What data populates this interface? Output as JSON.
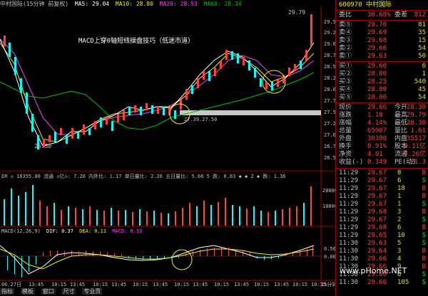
{
  "header": {
    "title": "中村国际(15分钟 前复权)",
    "ma": [
      {
        "label": "MA5: 29.04",
        "color": "#ffffff"
      },
      {
        "label": "MA10: 28.80",
        "color": "#f0f000"
      },
      {
        "label": "MA20: 28.53",
        "color": "#ff40ff"
      },
      {
        "label": "MA60: 28.34",
        "color": "#00c000"
      }
    ]
  },
  "chart_main": {
    "annotation": "MACD上穿0轴短线操盘技巧（低迷市道）",
    "high_label": "29.79",
    "low_label": "26.30",
    "mid_label": "27.39.27.50",
    "y_ticks": [
      "29.50",
      "29.25",
      "29.00",
      "28.75",
      "28.50",
      "28.25",
      "28.00",
      "27.75",
      "27.50",
      "27.25",
      "27.00",
      "26.75",
      "26.50"
    ],
    "highlight_color": "#c8c8c8"
  },
  "chart_vol": {
    "info": "ER ◇ 18355.00   流通 ◇亿◇: 7.26  内外比: 1.17  单日量比: 2.26  五日量比: 5.66  5 跌: 0.63  ◆ ◆  2 ◆ 跌: 1.36",
    "y_ticks": [
      "20000",
      "10000"
    ]
  },
  "chart_macd": {
    "info_parts": [
      {
        "text": "MACD(12,26,9)",
        "color": "#c0c0c0"
      },
      {
        "text": "DIF: 0.37",
        "color": "#ffffff"
      },
      {
        "text": "DEA: 0.11",
        "color": "#f0f000"
      },
      {
        "text": "MACD: 0.53",
        "color": "#ff40ff"
      }
    ],
    "y_ticks": [
      "0.50",
      "0.00"
    ]
  },
  "x_axis": [
    "06.27日",
    "13:45",
    "10:15",
    "13:45",
    "10:15",
    "13:45",
    "10:15",
    "13:45",
    "10:15",
    "13:45",
    "10:15",
    "13:45",
    "10:15",
    "13:45",
    "10:15",
    "10:15",
    "15分钟"
  ],
  "tabs": [
    "指标",
    "模板",
    "窗口",
    "尺寸",
    "专业页"
  ],
  "right": {
    "top_title": "600970  中村国际",
    "webi": {
      "label": "委比",
      "value": "30.68%",
      "label2": "委差",
      "value2": "812"
    },
    "sells": [
      {
        "label": "卖⑤",
        "price": "29.70",
        "vol": "81"
      },
      {
        "label": "卖④",
        "price": "29.69",
        "vol": "35"
      },
      {
        "label": "卖③",
        "price": "29.68",
        "vol": "15"
      },
      {
        "label": "卖②",
        "price": "29.66",
        "vol": "54"
      },
      {
        "label": "卖①",
        "price": "29.63",
        "vol": "50"
      }
    ],
    "buys": [
      {
        "label": "买①",
        "price": "29.60",
        "vol": "6"
      },
      {
        "label": "买②",
        "price": "28.80",
        "vol": "1"
      },
      {
        "label": "买③",
        "price": "28.25",
        "vol": "540"
      },
      {
        "label": "买④",
        "price": "28.00",
        "vol": "45"
      },
      {
        "label": "买⑤",
        "price": "28.00",
        "vol": "54"
      }
    ],
    "stats": [
      {
        "l1": "现价",
        "v1": "29.66",
        "l2": "今开",
        "v2": "28.30"
      },
      {
        "l1": "涨跌",
        "v1": "1.18",
        "l2": "最高",
        "v2": "29.79"
      },
      {
        "l1": "涨幅",
        "v1": "4.14%",
        "l2": "最低",
        "v2": "28.30"
      },
      {
        "l1": "总量",
        "v1": "65907",
        "l2": "量比",
        "v2": "1.61"
      },
      {
        "l1": "外盘",
        "v1": "30390",
        "l2": "内盘",
        "v2": "35517"
      },
      {
        "l1": "换手",
        "v1": "0.91%",
        "l2": "股本",
        "v2": "9.11亿"
      },
      {
        "l1": "净资",
        "v1": "4.01",
        "l2": "流通",
        "v2": "7.26亿"
      },
      {
        "l1": "收益(-)",
        "v1": "0.349",
        "l2": "PE(动)",
        "v2": "21.3"
      }
    ],
    "ticks": [
      {
        "t": "11:29",
        "p": "29.67",
        "v": "8",
        "d": "B"
      },
      {
        "t": "11:29",
        "p": "29.67",
        "v": "6",
        "d": "S"
      },
      {
        "t": "11:29",
        "p": "29.67",
        "v": "18",
        "d": "B"
      },
      {
        "t": "11:29",
        "p": "29.67",
        "v": "1",
        "d": "B"
      },
      {
        "t": "11:29",
        "p": "29.67",
        "v": "1",
        "d": "S"
      },
      {
        "t": "11:29",
        "p": "29.68",
        "v": "3",
        "d": "B"
      },
      {
        "t": "11:29",
        "p": "29.67",
        "v": "2",
        "d": "S"
      },
      {
        "t": "11:29",
        "p": "29.68",
        "v": "6",
        "d": "B"
      },
      {
        "t": "11:29",
        "p": "29.65",
        "v": "10",
        "d": "S"
      },
      {
        "t": "11:30",
        "p": "29.63",
        "v": "5",
        "d": "S"
      },
      {
        "t": "11:30",
        "p": "29.64",
        "v": "3",
        "d": "B"
      },
      {
        "t": "11:30",
        "p": "29.66",
        "v": "4",
        "d": "B"
      },
      {
        "t": "11:30",
        "p": "29.66",
        "v": "9",
        "d": "B"
      },
      {
        "t": "11:30",
        "p": "29.66",
        "v": "6",
        "d": "S"
      },
      {
        "t": "11:30",
        "p": "29.66",
        "v": "105",
        "d": "S"
      }
    ],
    "watermark": "www.pHome.NET"
  }
}
